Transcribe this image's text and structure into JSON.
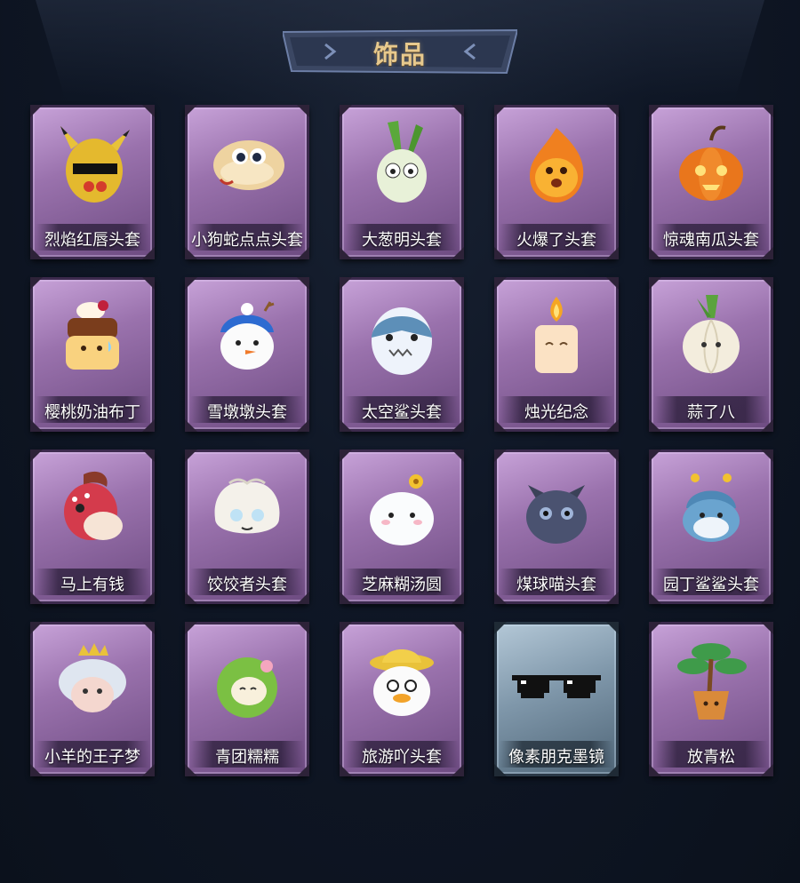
{
  "header": {
    "title": "饰品"
  },
  "items": [
    {
      "name": "烈焰红唇头套",
      "icon": "pikachu-glasses-hood-icon",
      "rarity": "purple"
    },
    {
      "name": "小狗蛇点点头套",
      "icon": "snake-hood-icon",
      "rarity": "purple"
    },
    {
      "name": "大葱明头套",
      "icon": "green-onion-hood-icon",
      "rarity": "purple"
    },
    {
      "name": "火爆了头套",
      "icon": "fire-sprite-hood-icon",
      "rarity": "purple"
    },
    {
      "name": "惊魂南瓜头套",
      "icon": "pumpkin-hood-icon",
      "rarity": "purple"
    },
    {
      "name": "樱桃奶油布丁",
      "icon": "pudding-hood-icon",
      "rarity": "purple"
    },
    {
      "name": "雪墩墩头套",
      "icon": "snowman-hood-icon",
      "rarity": "purple"
    },
    {
      "name": "太空鲨头套",
      "icon": "space-shark-hood-icon",
      "rarity": "purple"
    },
    {
      "name": "烛光纪念",
      "icon": "candle-hood-icon",
      "rarity": "purple"
    },
    {
      "name": "蒜了八",
      "icon": "garlic-hood-icon",
      "rarity": "purple"
    },
    {
      "name": "马上有钱",
      "icon": "horse-hood-icon",
      "rarity": "purple"
    },
    {
      "name": "饺饺者头套",
      "icon": "dumpling-hood-icon",
      "rarity": "purple"
    },
    {
      "name": "芝麻糊汤圆",
      "icon": "tangyuan-hood-icon",
      "rarity": "purple"
    },
    {
      "name": "煤球喵头套",
      "icon": "black-cat-hood-icon",
      "rarity": "purple"
    },
    {
      "name": "园丁鲨鲨头套",
      "icon": "gardener-shark-hood-icon",
      "rarity": "purple"
    },
    {
      "name": "小羊的王子梦",
      "icon": "sheep-crown-hood-icon",
      "rarity": "purple"
    },
    {
      "name": "青团糯糯",
      "icon": "green-dumpling-hood-icon",
      "rarity": "purple"
    },
    {
      "name": "旅游吖头套",
      "icon": "duck-hat-hood-icon",
      "rarity": "purple"
    },
    {
      "name": "像素朋克墨镜",
      "icon": "pixel-sunglasses-icon",
      "rarity": "blue"
    },
    {
      "name": "放青松",
      "icon": "bonsai-pine-icon",
      "rarity": "purple"
    }
  ]
}
